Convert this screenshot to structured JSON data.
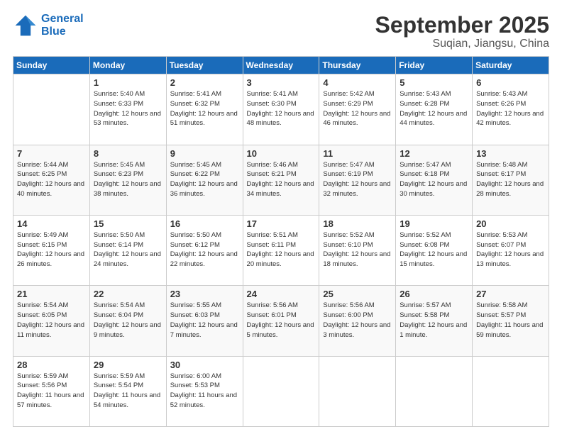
{
  "header": {
    "logo_line1": "General",
    "logo_line2": "Blue",
    "title": "September 2025",
    "subtitle": "Suqian, Jiangsu, China"
  },
  "calendar": {
    "columns": [
      "Sunday",
      "Monday",
      "Tuesday",
      "Wednesday",
      "Thursday",
      "Friday",
      "Saturday"
    ],
    "rows": [
      [
        {
          "day": "",
          "sunrise": "",
          "sunset": "",
          "daylight": ""
        },
        {
          "day": "1",
          "sunrise": "Sunrise: 5:40 AM",
          "sunset": "Sunset: 6:33 PM",
          "daylight": "Daylight: 12 hours and 53 minutes."
        },
        {
          "day": "2",
          "sunrise": "Sunrise: 5:41 AM",
          "sunset": "Sunset: 6:32 PM",
          "daylight": "Daylight: 12 hours and 51 minutes."
        },
        {
          "day": "3",
          "sunrise": "Sunrise: 5:41 AM",
          "sunset": "Sunset: 6:30 PM",
          "daylight": "Daylight: 12 hours and 48 minutes."
        },
        {
          "day": "4",
          "sunrise": "Sunrise: 5:42 AM",
          "sunset": "Sunset: 6:29 PM",
          "daylight": "Daylight: 12 hours and 46 minutes."
        },
        {
          "day": "5",
          "sunrise": "Sunrise: 5:43 AM",
          "sunset": "Sunset: 6:28 PM",
          "daylight": "Daylight: 12 hours and 44 minutes."
        },
        {
          "day": "6",
          "sunrise": "Sunrise: 5:43 AM",
          "sunset": "Sunset: 6:26 PM",
          "daylight": "Daylight: 12 hours and 42 minutes."
        }
      ],
      [
        {
          "day": "7",
          "sunrise": "Sunrise: 5:44 AM",
          "sunset": "Sunset: 6:25 PM",
          "daylight": "Daylight: 12 hours and 40 minutes."
        },
        {
          "day": "8",
          "sunrise": "Sunrise: 5:45 AM",
          "sunset": "Sunset: 6:23 PM",
          "daylight": "Daylight: 12 hours and 38 minutes."
        },
        {
          "day": "9",
          "sunrise": "Sunrise: 5:45 AM",
          "sunset": "Sunset: 6:22 PM",
          "daylight": "Daylight: 12 hours and 36 minutes."
        },
        {
          "day": "10",
          "sunrise": "Sunrise: 5:46 AM",
          "sunset": "Sunset: 6:21 PM",
          "daylight": "Daylight: 12 hours and 34 minutes."
        },
        {
          "day": "11",
          "sunrise": "Sunrise: 5:47 AM",
          "sunset": "Sunset: 6:19 PM",
          "daylight": "Daylight: 12 hours and 32 minutes."
        },
        {
          "day": "12",
          "sunrise": "Sunrise: 5:47 AM",
          "sunset": "Sunset: 6:18 PM",
          "daylight": "Daylight: 12 hours and 30 minutes."
        },
        {
          "day": "13",
          "sunrise": "Sunrise: 5:48 AM",
          "sunset": "Sunset: 6:17 PM",
          "daylight": "Daylight: 12 hours and 28 minutes."
        }
      ],
      [
        {
          "day": "14",
          "sunrise": "Sunrise: 5:49 AM",
          "sunset": "Sunset: 6:15 PM",
          "daylight": "Daylight: 12 hours and 26 minutes."
        },
        {
          "day": "15",
          "sunrise": "Sunrise: 5:50 AM",
          "sunset": "Sunset: 6:14 PM",
          "daylight": "Daylight: 12 hours and 24 minutes."
        },
        {
          "day": "16",
          "sunrise": "Sunrise: 5:50 AM",
          "sunset": "Sunset: 6:12 PM",
          "daylight": "Daylight: 12 hours and 22 minutes."
        },
        {
          "day": "17",
          "sunrise": "Sunrise: 5:51 AM",
          "sunset": "Sunset: 6:11 PM",
          "daylight": "Daylight: 12 hours and 20 minutes."
        },
        {
          "day": "18",
          "sunrise": "Sunrise: 5:52 AM",
          "sunset": "Sunset: 6:10 PM",
          "daylight": "Daylight: 12 hours and 18 minutes."
        },
        {
          "day": "19",
          "sunrise": "Sunrise: 5:52 AM",
          "sunset": "Sunset: 6:08 PM",
          "daylight": "Daylight: 12 hours and 15 minutes."
        },
        {
          "day": "20",
          "sunrise": "Sunrise: 5:53 AM",
          "sunset": "Sunset: 6:07 PM",
          "daylight": "Daylight: 12 hours and 13 minutes."
        }
      ],
      [
        {
          "day": "21",
          "sunrise": "Sunrise: 5:54 AM",
          "sunset": "Sunset: 6:05 PM",
          "daylight": "Daylight: 12 hours and 11 minutes."
        },
        {
          "day": "22",
          "sunrise": "Sunrise: 5:54 AM",
          "sunset": "Sunset: 6:04 PM",
          "daylight": "Daylight: 12 hours and 9 minutes."
        },
        {
          "day": "23",
          "sunrise": "Sunrise: 5:55 AM",
          "sunset": "Sunset: 6:03 PM",
          "daylight": "Daylight: 12 hours and 7 minutes."
        },
        {
          "day": "24",
          "sunrise": "Sunrise: 5:56 AM",
          "sunset": "Sunset: 6:01 PM",
          "daylight": "Daylight: 12 hours and 5 minutes."
        },
        {
          "day": "25",
          "sunrise": "Sunrise: 5:56 AM",
          "sunset": "Sunset: 6:00 PM",
          "daylight": "Daylight: 12 hours and 3 minutes."
        },
        {
          "day": "26",
          "sunrise": "Sunrise: 5:57 AM",
          "sunset": "Sunset: 5:58 PM",
          "daylight": "Daylight: 12 hours and 1 minute."
        },
        {
          "day": "27",
          "sunrise": "Sunrise: 5:58 AM",
          "sunset": "Sunset: 5:57 PM",
          "daylight": "Daylight: 11 hours and 59 minutes."
        }
      ],
      [
        {
          "day": "28",
          "sunrise": "Sunrise: 5:59 AM",
          "sunset": "Sunset: 5:56 PM",
          "daylight": "Daylight: 11 hours and 57 minutes."
        },
        {
          "day": "29",
          "sunrise": "Sunrise: 5:59 AM",
          "sunset": "Sunset: 5:54 PM",
          "daylight": "Daylight: 11 hours and 54 minutes."
        },
        {
          "day": "30",
          "sunrise": "Sunrise: 6:00 AM",
          "sunset": "Sunset: 5:53 PM",
          "daylight": "Daylight: 11 hours and 52 minutes."
        },
        {
          "day": "",
          "sunrise": "",
          "sunset": "",
          "daylight": ""
        },
        {
          "day": "",
          "sunrise": "",
          "sunset": "",
          "daylight": ""
        },
        {
          "day": "",
          "sunrise": "",
          "sunset": "",
          "daylight": ""
        },
        {
          "day": "",
          "sunrise": "",
          "sunset": "",
          "daylight": ""
        }
      ]
    ]
  }
}
